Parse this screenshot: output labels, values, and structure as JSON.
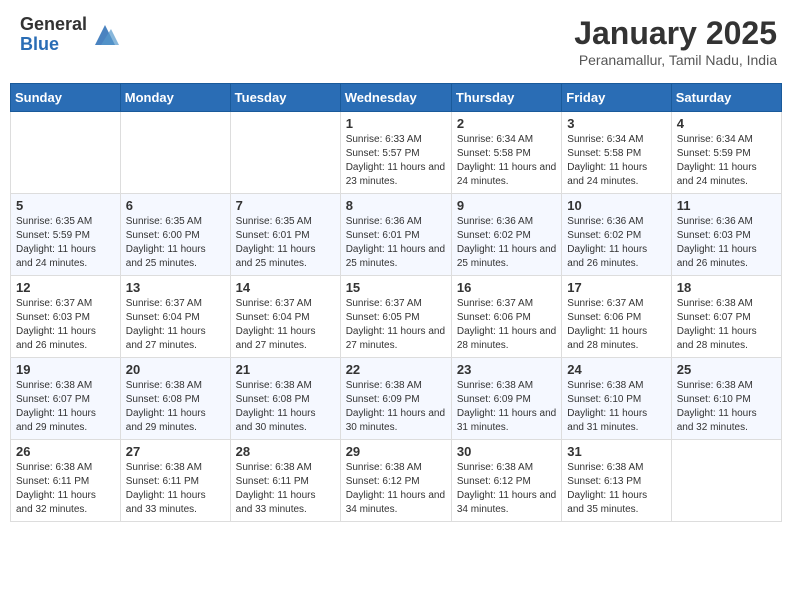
{
  "header": {
    "logo_general": "General",
    "logo_blue": "Blue",
    "month_year": "January 2025",
    "location": "Peranamallur, Tamil Nadu, India"
  },
  "days_of_week": [
    "Sunday",
    "Monday",
    "Tuesday",
    "Wednesday",
    "Thursday",
    "Friday",
    "Saturday"
  ],
  "weeks": [
    [
      {
        "day": "",
        "info": ""
      },
      {
        "day": "",
        "info": ""
      },
      {
        "day": "",
        "info": ""
      },
      {
        "day": "1",
        "info": "Sunrise: 6:33 AM\nSunset: 5:57 PM\nDaylight: 11 hours and 23 minutes."
      },
      {
        "day": "2",
        "info": "Sunrise: 6:34 AM\nSunset: 5:58 PM\nDaylight: 11 hours and 24 minutes."
      },
      {
        "day": "3",
        "info": "Sunrise: 6:34 AM\nSunset: 5:58 PM\nDaylight: 11 hours and 24 minutes."
      },
      {
        "day": "4",
        "info": "Sunrise: 6:34 AM\nSunset: 5:59 PM\nDaylight: 11 hours and 24 minutes."
      }
    ],
    [
      {
        "day": "5",
        "info": "Sunrise: 6:35 AM\nSunset: 5:59 PM\nDaylight: 11 hours and 24 minutes."
      },
      {
        "day": "6",
        "info": "Sunrise: 6:35 AM\nSunset: 6:00 PM\nDaylight: 11 hours and 25 minutes."
      },
      {
        "day": "7",
        "info": "Sunrise: 6:35 AM\nSunset: 6:01 PM\nDaylight: 11 hours and 25 minutes."
      },
      {
        "day": "8",
        "info": "Sunrise: 6:36 AM\nSunset: 6:01 PM\nDaylight: 11 hours and 25 minutes."
      },
      {
        "day": "9",
        "info": "Sunrise: 6:36 AM\nSunset: 6:02 PM\nDaylight: 11 hours and 25 minutes."
      },
      {
        "day": "10",
        "info": "Sunrise: 6:36 AM\nSunset: 6:02 PM\nDaylight: 11 hours and 26 minutes."
      },
      {
        "day": "11",
        "info": "Sunrise: 6:36 AM\nSunset: 6:03 PM\nDaylight: 11 hours and 26 minutes."
      }
    ],
    [
      {
        "day": "12",
        "info": "Sunrise: 6:37 AM\nSunset: 6:03 PM\nDaylight: 11 hours and 26 minutes."
      },
      {
        "day": "13",
        "info": "Sunrise: 6:37 AM\nSunset: 6:04 PM\nDaylight: 11 hours and 27 minutes."
      },
      {
        "day": "14",
        "info": "Sunrise: 6:37 AM\nSunset: 6:04 PM\nDaylight: 11 hours and 27 minutes."
      },
      {
        "day": "15",
        "info": "Sunrise: 6:37 AM\nSunset: 6:05 PM\nDaylight: 11 hours and 27 minutes."
      },
      {
        "day": "16",
        "info": "Sunrise: 6:37 AM\nSunset: 6:06 PM\nDaylight: 11 hours and 28 minutes."
      },
      {
        "day": "17",
        "info": "Sunrise: 6:37 AM\nSunset: 6:06 PM\nDaylight: 11 hours and 28 minutes."
      },
      {
        "day": "18",
        "info": "Sunrise: 6:38 AM\nSunset: 6:07 PM\nDaylight: 11 hours and 28 minutes."
      }
    ],
    [
      {
        "day": "19",
        "info": "Sunrise: 6:38 AM\nSunset: 6:07 PM\nDaylight: 11 hours and 29 minutes."
      },
      {
        "day": "20",
        "info": "Sunrise: 6:38 AM\nSunset: 6:08 PM\nDaylight: 11 hours and 29 minutes."
      },
      {
        "day": "21",
        "info": "Sunrise: 6:38 AM\nSunset: 6:08 PM\nDaylight: 11 hours and 30 minutes."
      },
      {
        "day": "22",
        "info": "Sunrise: 6:38 AM\nSunset: 6:09 PM\nDaylight: 11 hours and 30 minutes."
      },
      {
        "day": "23",
        "info": "Sunrise: 6:38 AM\nSunset: 6:09 PM\nDaylight: 11 hours and 31 minutes."
      },
      {
        "day": "24",
        "info": "Sunrise: 6:38 AM\nSunset: 6:10 PM\nDaylight: 11 hours and 31 minutes."
      },
      {
        "day": "25",
        "info": "Sunrise: 6:38 AM\nSunset: 6:10 PM\nDaylight: 11 hours and 32 minutes."
      }
    ],
    [
      {
        "day": "26",
        "info": "Sunrise: 6:38 AM\nSunset: 6:11 PM\nDaylight: 11 hours and 32 minutes."
      },
      {
        "day": "27",
        "info": "Sunrise: 6:38 AM\nSunset: 6:11 PM\nDaylight: 11 hours and 33 minutes."
      },
      {
        "day": "28",
        "info": "Sunrise: 6:38 AM\nSunset: 6:11 PM\nDaylight: 11 hours and 33 minutes."
      },
      {
        "day": "29",
        "info": "Sunrise: 6:38 AM\nSunset: 6:12 PM\nDaylight: 11 hours and 34 minutes."
      },
      {
        "day": "30",
        "info": "Sunrise: 6:38 AM\nSunset: 6:12 PM\nDaylight: 11 hours and 34 minutes."
      },
      {
        "day": "31",
        "info": "Sunrise: 6:38 AM\nSunset: 6:13 PM\nDaylight: 11 hours and 35 minutes."
      },
      {
        "day": "",
        "info": ""
      }
    ]
  ]
}
